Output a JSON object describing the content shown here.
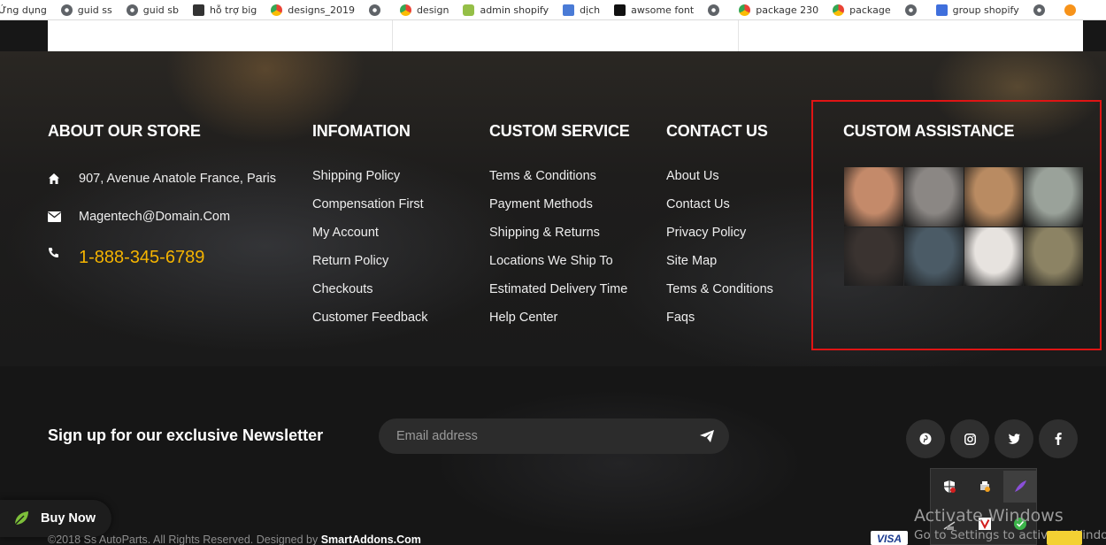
{
  "bookmarks": [
    {
      "label": "Ứng dụng",
      "icon": "apps-icon"
    },
    {
      "label": "guid ss",
      "icon": "globe-icon"
    },
    {
      "label": "guid sb",
      "icon": "globe-icon"
    },
    {
      "label": "hỗ trợ big",
      "icon": "blog-icon"
    },
    {
      "label": "designs_2019",
      "icon": "chrome-icon"
    },
    {
      "label": "",
      "icon": "globe-icon"
    },
    {
      "label": "design",
      "icon": "chrome-icon"
    },
    {
      "label": "admin shopify",
      "icon": "shopify-icon"
    },
    {
      "label": "dịch",
      "icon": "translate-icon"
    },
    {
      "label": "awsome font",
      "icon": "font-awesome-icon"
    },
    {
      "label": "",
      "icon": "globe-icon"
    },
    {
      "label": "package 230",
      "icon": "chrome-icon"
    },
    {
      "label": "package",
      "icon": "chrome-icon"
    },
    {
      "label": "",
      "icon": "globe-icon"
    },
    {
      "label": "group shopify",
      "icon": "docs-icon"
    },
    {
      "label": "",
      "icon": "globe-icon"
    },
    {
      "label": "",
      "icon": "bitcoin-icon"
    }
  ],
  "about": {
    "title": "ABOUT OUR STORE",
    "address": "907, Avenue Anatole France, Paris",
    "email": "Magentech@Domain.Com",
    "phone": "1-888-345-6789"
  },
  "information": {
    "title": "INFOMATION",
    "links": [
      "Shipping Policy",
      "Compensation First",
      "My Account",
      "Return Policy",
      "Checkouts",
      "Customer Feedback"
    ]
  },
  "custom_service": {
    "title": "CUSTOM SERVICE",
    "links": [
      "Tems & Conditions",
      "Payment Methods",
      "Shipping & Returns",
      "Locations We Ship To",
      "Estimated Delivery Time",
      "Help Center"
    ]
  },
  "contact": {
    "title": "CONTACT US",
    "links": [
      "About Us",
      "Contact Us",
      "Privacy Policy",
      "Site Map",
      "Tems & Conditions",
      "Faqs"
    ]
  },
  "assistance": {
    "title": "CUSTOM ASSISTANCE",
    "photos": [
      {
        "name": "photo-necklace",
        "color": "#c48a6a"
      },
      {
        "name": "photo-man-tattoo",
        "color": "#8b8784"
      },
      {
        "name": "photo-cosmetics",
        "color": "#b98b62"
      },
      {
        "name": "photo-cactus",
        "color": "#9aa29a"
      },
      {
        "name": "photo-women-fashion",
        "color": "#3a3330"
      },
      {
        "name": "photo-man-glasses",
        "color": "#4b5b66"
      },
      {
        "name": "photo-white-sweater",
        "color": "#e7e3df"
      },
      {
        "name": "photo-woman-outdoor",
        "color": "#8c8364"
      }
    ]
  },
  "newsletter": {
    "title": "Sign up for our exclusive Newsletter",
    "placeholder": "Email address"
  },
  "social": [
    "P",
    "◎",
    "t",
    "f"
  ],
  "buy_now": "Buy Now",
  "copyright": {
    "text": "©2018 Ss AutoParts. All Rights Reserved. Designed by ",
    "link": "SmartAddons.Com"
  },
  "windows": {
    "title": "Activate Windows",
    "subtitle": "Go to Settings to activate Windows."
  },
  "colors": {
    "accent_phone": "#f5b400",
    "highlight": "#e01414"
  }
}
